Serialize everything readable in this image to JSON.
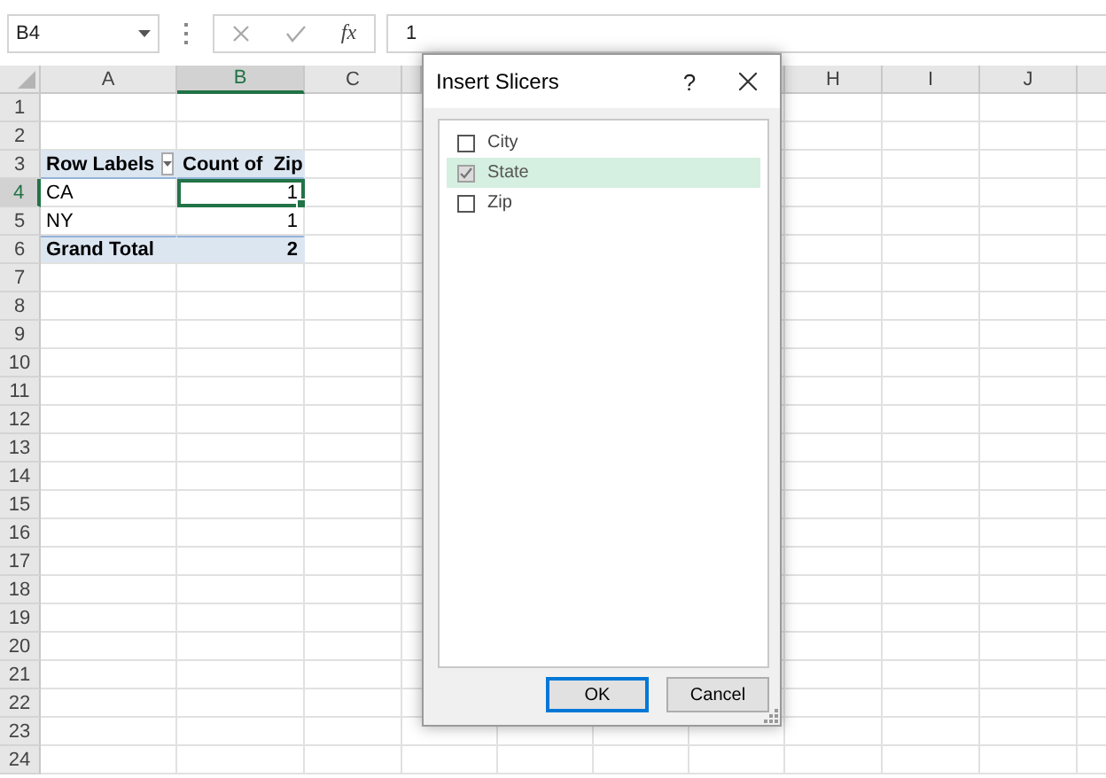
{
  "formula_bar": {
    "name_box": "B4",
    "function_label": "fx",
    "formula": "1"
  },
  "columns": [
    {
      "kind": "label",
      "label": "A",
      "selected": false
    },
    {
      "kind": "label",
      "label": "B",
      "selected": true
    },
    {
      "kind": "label",
      "label": "C",
      "selected": false
    },
    {
      "kind": "blank"
    },
    {
      "kind": "blank"
    },
    {
      "kind": "blank"
    },
    {
      "kind": "blank"
    },
    {
      "kind": "label",
      "label": "H",
      "selected": false
    },
    {
      "kind": "label",
      "label": "I",
      "selected": false
    },
    {
      "kind": "label",
      "label": "J",
      "selected": false
    },
    {
      "kind": "blank"
    }
  ],
  "rows": [
    {
      "number": "1",
      "selected": false
    },
    {
      "number": "2",
      "selected": false
    },
    {
      "number": "3",
      "selected": false,
      "cells": [
        {
          "kind": "filter-label",
          "text": "Row Labels",
          "selected": false
        },
        {
          "kind": "head",
          "text": "Count of  Zip",
          "selected": false
        }
      ]
    },
    {
      "number": "4",
      "selected": true,
      "cells": [
        {
          "kind": "label",
          "text": "CA",
          "selected": false
        },
        {
          "kind": "value",
          "text": "1",
          "selected": true
        }
      ]
    },
    {
      "number": "5",
      "selected": false,
      "cells": [
        {
          "kind": "label",
          "text": "NY",
          "selected": false
        },
        {
          "kind": "value",
          "text": "1",
          "selected": false
        }
      ]
    },
    {
      "number": "6",
      "selected": false,
      "cells": [
        {
          "kind": "head",
          "text": "Grand Total",
          "selected": false
        },
        {
          "kind": "total",
          "text": "2",
          "selected": false
        }
      ]
    },
    {
      "number": "7",
      "selected": false
    },
    {
      "number": "8",
      "selected": false
    },
    {
      "number": "9",
      "selected": false
    },
    {
      "number": "10",
      "selected": false
    },
    {
      "number": "11",
      "selected": false
    },
    {
      "number": "12",
      "selected": false
    },
    {
      "number": "13",
      "selected": false
    },
    {
      "number": "14",
      "selected": false
    },
    {
      "number": "15",
      "selected": false
    },
    {
      "number": "16",
      "selected": false
    },
    {
      "number": "17",
      "selected": false
    },
    {
      "number": "18",
      "selected": false
    },
    {
      "number": "19",
      "selected": false
    },
    {
      "number": "20",
      "selected": false
    },
    {
      "number": "21",
      "selected": false
    },
    {
      "number": "22",
      "selected": false
    },
    {
      "number": "23",
      "selected": false
    },
    {
      "number": "24",
      "selected": false
    }
  ],
  "dialog": {
    "title": "Insert Slicers",
    "help": "?",
    "items": [
      {
        "label": "City",
        "checked": false,
        "disabled": false,
        "selected": false
      },
      {
        "label": "State",
        "checked": true,
        "disabled": true,
        "selected": true
      },
      {
        "label": "Zip",
        "checked": false,
        "disabled": false,
        "selected": false
      }
    ],
    "buttons": [
      {
        "label": "OK",
        "focused": true
      },
      {
        "label": "Cancel",
        "focused": false
      }
    ]
  }
}
